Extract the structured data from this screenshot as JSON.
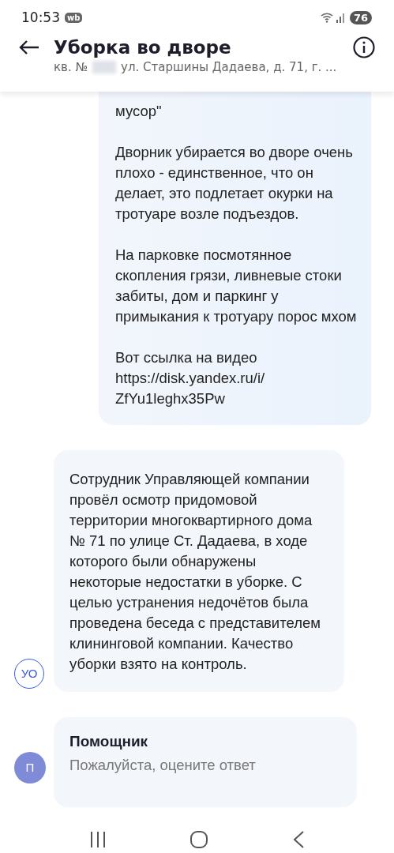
{
  "status_bar": {
    "time": "10:53",
    "app_badge": "wb",
    "battery": "76"
  },
  "header": {
    "title": "Уборка во дворе",
    "address_prefix": "кв. №",
    "address": "ул. Старшины Дадаева, д. 71, г. ..."
  },
  "messages": [
    {
      "kind": "outgoing",
      "paragraphs": [
        "мусор\"",
        "Дворник убирается во дворе очень плохо - единственное, что он делает, это подлетает окурки на тротуаре возле подъездов.",
        "На парковке посмотянное скопления грязи, ливневые стоки забиты, дом и паркинг у примыкания к тротуару порос мхом",
        "Вот ссылка на видео https://disk.yandex.ru/i/ ZfYu1leghx35Pw"
      ]
    },
    {
      "kind": "incoming",
      "avatar": "УО",
      "paragraphs": [
        "Сотрудник Управляющей компании провёл осмотр придомовой территории многоквартирного дома № 71 по улице Ст. Дадаева, в ходе которого были обнаружены некоторые недостатки в уборке. С целью устранения недочётов была проведена беседа с представителем клининговой компании. Качество уборки взято на контроль."
      ]
    },
    {
      "kind": "assistant",
      "avatar": "П",
      "title": "Помощник",
      "paragraphs": [
        "Пожалуйста, оцените ответ"
      ]
    }
  ]
}
